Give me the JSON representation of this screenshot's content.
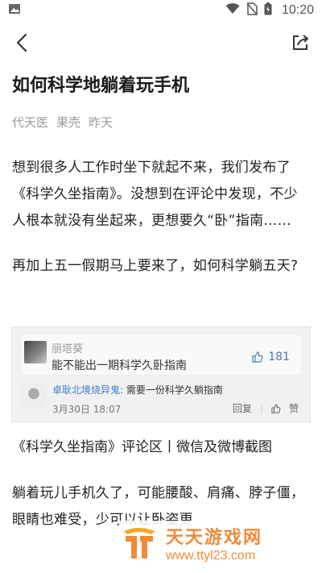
{
  "status_bar": {
    "time": "10:20"
  },
  "article": {
    "title": "如何科学地躺着玩手机",
    "meta": {
      "author": "代天医",
      "source": "果壳",
      "date": "昨天"
    },
    "paragraphs": [
      "想到很多人工作时坐下就起不来，我们发布了《科学久坐指南》。没想到在评论中发现，不少人根本就没有坐起来，更想要久“卧”指南……",
      "再加上五一假期马上要来了，如何科学躺五天?"
    ],
    "caption": "《科学久坐指南》评论区丨微信及微博截图",
    "paragraph_partial": "躺着玩儿手机久了，可能腰酸、肩痛、脖子僵，眼睛也难受，少可以让卧姿更"
  },
  "screenshot": {
    "comment1": {
      "user": "丽塔葵",
      "text": "能不能出一期科学久卧指南",
      "likes": "181"
    },
    "comment2": {
      "user": "卓耿北境烧异鬼:",
      "text": "需要一份科学久躺指南",
      "date": "3月30日 18:07",
      "reply": "回复",
      "like": "赞"
    }
  },
  "watermark": {
    "name": "天天游戏网",
    "url": "www.ttyl23.com"
  }
}
